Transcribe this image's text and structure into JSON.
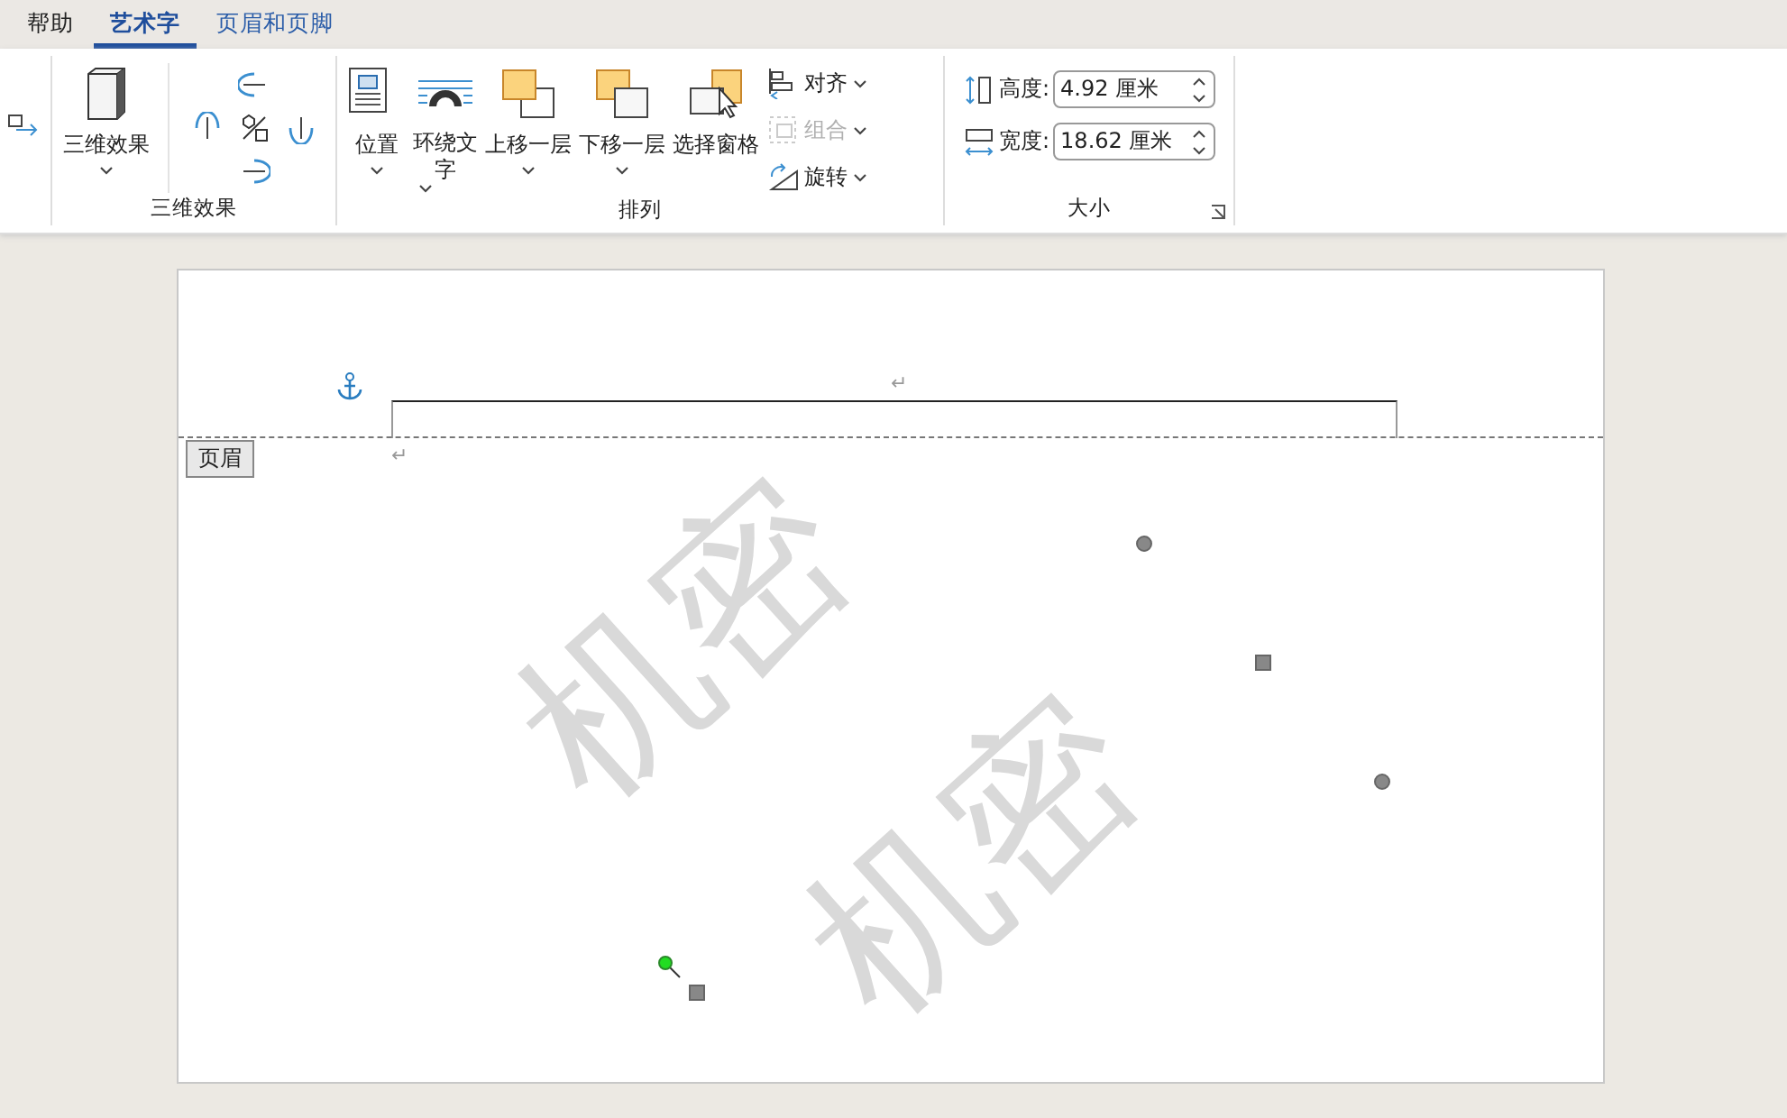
{
  "tabs": [
    {
      "label": "帮助",
      "selected": false,
      "kind": "standard"
    },
    {
      "label": "艺术字",
      "selected": true,
      "kind": "contextual"
    },
    {
      "label": "页眉和页脚",
      "selected": false,
      "kind": "contextual"
    }
  ],
  "ribbon": {
    "groups": [
      {
        "kind": "edge"
      },
      {
        "kind": "effects3d",
        "title": "三维效果",
        "button": {
          "label": "三维效果",
          "dropdown": true
        }
      },
      {
        "kind": "arrange",
        "title": "排列",
        "buttons": [
          {
            "label": "位置",
            "dropdown": true
          },
          {
            "label": "环绕文字",
            "dropdown": true
          },
          {
            "label": "上移一层",
            "dropdown": true
          },
          {
            "label": "下移一层",
            "dropdown": true
          },
          {
            "label": "选择窗格",
            "dropdown": false
          }
        ],
        "small_buttons": [
          {
            "label": "对齐",
            "disabled": false
          },
          {
            "label": "组合",
            "disabled": true
          },
          {
            "label": "旋转",
            "disabled": false
          }
        ]
      },
      {
        "kind": "size",
        "title": "大小",
        "fields": [
          {
            "label": "高度:",
            "value": "4.92 厘米"
          },
          {
            "label": "宽度:",
            "value": "18.62 厘米"
          }
        ]
      }
    ]
  },
  "document": {
    "header_label": "页眉",
    "header_marks": [
      "↵",
      "↵"
    ],
    "wordart": [
      "机密",
      "机密"
    ]
  }
}
